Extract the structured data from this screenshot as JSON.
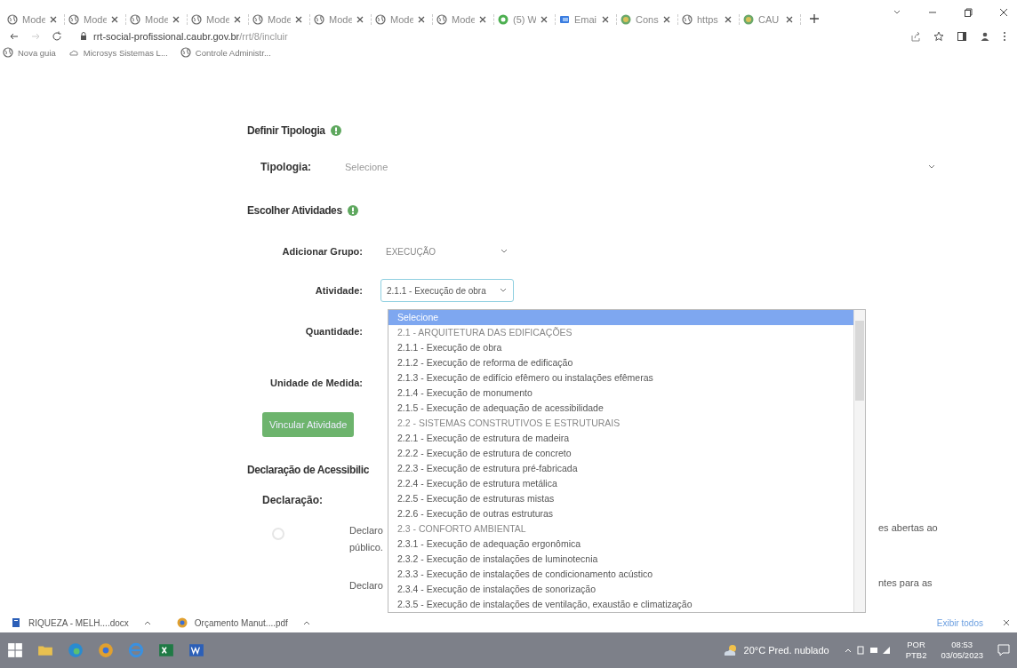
{
  "browser": {
    "tabs": [
      {
        "label": "Mode"
      },
      {
        "label": "Mode"
      },
      {
        "label": "Mode"
      },
      {
        "label": "Mode"
      },
      {
        "label": "Mode"
      },
      {
        "label": "Mode"
      },
      {
        "label": "Mode"
      },
      {
        "label": "Mode"
      },
      {
        "label": "(5) W"
      },
      {
        "label": "Emai"
      },
      {
        "label": "Cons"
      },
      {
        "label": "https"
      },
      {
        "label": "CAU"
      }
    ],
    "url_host": "rrt-social-profissional.caubr.gov.br",
    "url_path": "/rrt/8/incluir",
    "bookmarks": [
      {
        "label": "Nova guia"
      },
      {
        "label": "Microsys Sistemas L..."
      },
      {
        "label": "Controle Administr..."
      }
    ]
  },
  "form": {
    "tipologia_heading": "Definir Tipologia",
    "tipologia_label": "Tipologia:",
    "tipologia_value": "Selecione",
    "atividades_heading": "Escolher Atividades",
    "grupo_label": "Adicionar Grupo:",
    "grupo_value": "EXECUÇÃO",
    "atividade_label": "Atividade:",
    "atividade_value": "2.1.1 - Execução de obra",
    "quantidade_label": "Quantidade:",
    "unidade_label": "Unidade de Medida:",
    "vincular_button": "Vincular Atividade",
    "acessibilidade_heading": "Declaração de Acessibilic",
    "declaracao_label": "Declaração:",
    "declarations": [
      {
        "left_lines": [
          "Declaro",
          "público."
        ],
        "right": "es abertas ao"
      },
      {
        "left_lines": [
          "Declaro"
        ],
        "right": "ntes para as"
      }
    ]
  },
  "dropdown": [
    {
      "label": "Selecione",
      "kind": "option",
      "selected": true
    },
    {
      "label": "2.1 - ARQUITETURA DAS EDIFICAÇÕES",
      "kind": "group",
      "selected": false
    },
    {
      "label": "2.1.1 - Execução de obra",
      "kind": "option",
      "selected": false
    },
    {
      "label": "2.1.2 - Execução de reforma de edificação",
      "kind": "option",
      "selected": false
    },
    {
      "label": "2.1.3 - Execução de edifício efêmero ou instalações efêmeras",
      "kind": "option",
      "selected": false
    },
    {
      "label": "2.1.4 - Execução de monumento",
      "kind": "option",
      "selected": false
    },
    {
      "label": "2.1.5 - Execução de adequação de acessibilidade",
      "kind": "option",
      "selected": false
    },
    {
      "label": "2.2 - SISTEMAS CONSTRUTIVOS E ESTRUTURAIS",
      "kind": "group",
      "selected": false
    },
    {
      "label": "2.2.1 - Execução de estrutura de madeira",
      "kind": "option",
      "selected": false
    },
    {
      "label": "2.2.2 - Execução de estrutura de concreto",
      "kind": "option",
      "selected": false
    },
    {
      "label": "2.2.3 - Execução de estrutura pré-fabricada",
      "kind": "option",
      "selected": false
    },
    {
      "label": "2.2.4 - Execução de estrutura metálica",
      "kind": "option",
      "selected": false
    },
    {
      "label": "2.2.5 - Execução de estruturas mistas",
      "kind": "option",
      "selected": false
    },
    {
      "label": "2.2.6 - Execução de outras estruturas",
      "kind": "option",
      "selected": false
    },
    {
      "label": "2.3 - CONFORTO AMBIENTAL",
      "kind": "group",
      "selected": false
    },
    {
      "label": "2.3.1 - Execução de adequação ergonômica",
      "kind": "option",
      "selected": false
    },
    {
      "label": "2.3.2 - Execução de instalações de luminotecnia",
      "kind": "option",
      "selected": false
    },
    {
      "label": "2.3.3 - Execução de instalações de condicionamento acústico",
      "kind": "option",
      "selected": false
    },
    {
      "label": "2.3.4 - Execução de instalações de sonorização",
      "kind": "option",
      "selected": false
    },
    {
      "label": "2.3.5 - Execução de instalações de ventilação, exaustão e climatização",
      "kind": "option",
      "selected": false
    }
  ],
  "downloads": {
    "files": [
      {
        "name": "RIQUEZA - MELH....docx"
      },
      {
        "name": "Orçamento Manut....pdf"
      }
    ],
    "show_all": "Exibir todos"
  },
  "taskbar": {
    "weather": "20°C Pred. nublado",
    "lang": "POR",
    "layout": "PTB2",
    "time": "08:53",
    "date": "03/05/2023"
  }
}
